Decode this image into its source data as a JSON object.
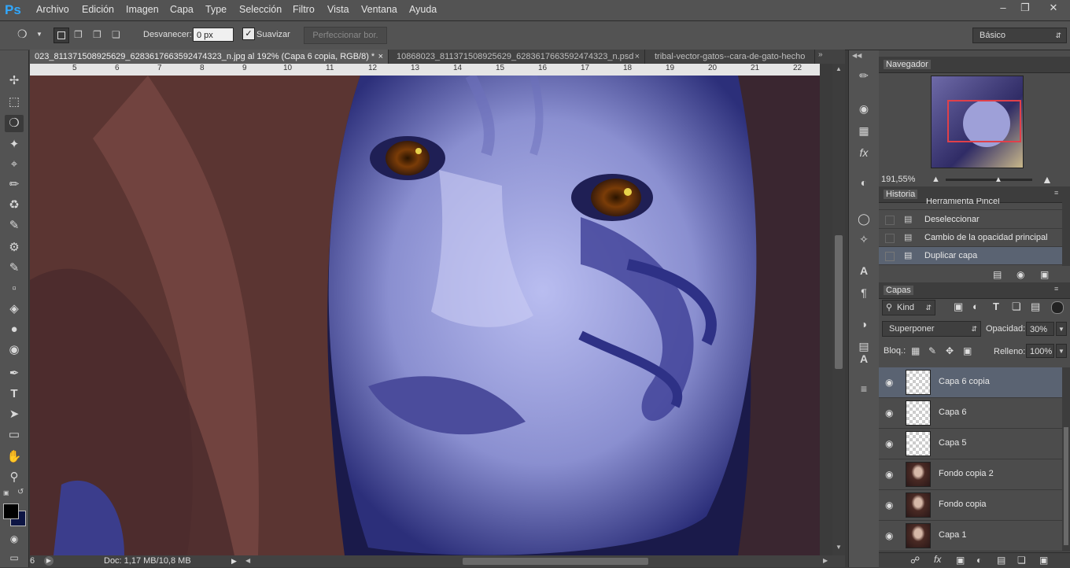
{
  "app": {
    "logo": "Ps",
    "menu": [
      "Archivo",
      "Edición",
      "Imagen",
      "Capa",
      "Type",
      "Selección",
      "Filtro",
      "Vista",
      "Ventana",
      "Ayuda"
    ]
  },
  "options": {
    "feather_label": "Desvanecer:",
    "feather_value": "0 px",
    "antialias_label": "Suavizar",
    "refine_label": "Perfeccionar bor.",
    "workspace": "Básico"
  },
  "tabs": [
    {
      "label": "023_811371508925629_6283617663592474323_n.jpg al 192% (Capa 6 copia, RGB/8) *",
      "active": true
    },
    {
      "label": "10868023_811371508925629_6283617663592474323_n.psd",
      "active": false
    },
    {
      "label": "tribal-vector-gatos--cara-de-gato-hecho",
      "active": false
    }
  ],
  "ruler_top": [
    "5",
    "6",
    "7",
    "8",
    "9",
    "10",
    "11",
    "12",
    "13",
    "14",
    "15",
    "16",
    "17",
    "18",
    "19",
    "20",
    "21",
    "22"
  ],
  "status": {
    "zoom": "6",
    "doc": "Doc: 1,17 MB/10,8 MB"
  },
  "navigator": {
    "title": "Navegador",
    "zoom": "191,55%"
  },
  "history": {
    "title": "Historia",
    "items": [
      "Herramienta Pincel",
      "Deseleccionar",
      "Cambio de la opacidad principal",
      "Duplicar capa"
    ]
  },
  "layers": {
    "title": "Capas",
    "filter": "Kind",
    "blend_mode": "Superponer",
    "opacity_label": "Opacidad:",
    "opacity": "30%",
    "lock_label": "Bloq.:",
    "fill_label": "Relleno:",
    "fill": "100%",
    "items": [
      {
        "name": "Capa 6 copia",
        "thumb": "transparent"
      },
      {
        "name": "Capa 6",
        "thumb": "transparent"
      },
      {
        "name": "Capa 5",
        "thumb": "transparent"
      },
      {
        "name": "Fondo copia 2",
        "thumb": "photo"
      },
      {
        "name": "Fondo copia",
        "thumb": "photo"
      },
      {
        "name": "Capa 1",
        "thumb": "photo"
      }
    ]
  },
  "colors": {
    "foreground": "#000000",
    "background": "#0d1544",
    "accent": "#31a8ff"
  }
}
